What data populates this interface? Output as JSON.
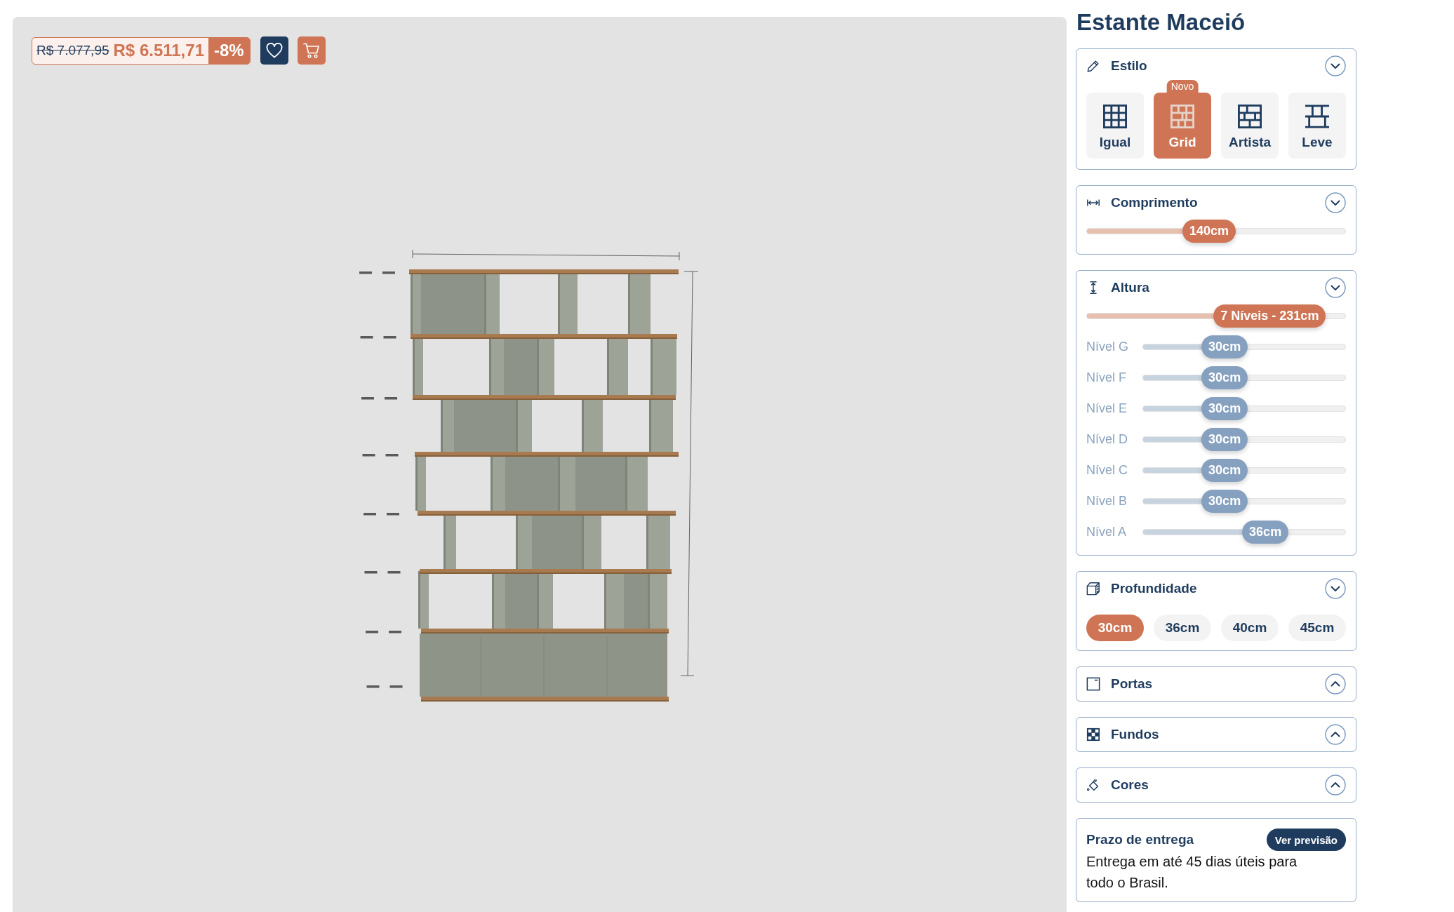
{
  "viewer": {
    "price": {
      "original": "R$ 7.077,95",
      "current": "R$ 6.511,71",
      "discount": "-8%"
    }
  },
  "product": {
    "title": "Estante Maceió"
  },
  "sections": [
    {
      "kind": "styles",
      "title": "Estilo",
      "expanded": true,
      "options": [
        {
          "label": "Igual",
          "selected": false
        },
        {
          "label": "Grid",
          "selected": true,
          "badge": "Novo"
        },
        {
          "label": "Artista",
          "selected": false
        },
        {
          "label": "Leve",
          "selected": false
        }
      ]
    },
    {
      "kind": "slider",
      "title": "Comprimento",
      "expanded": true,
      "slider": {
        "value": "140cm",
        "level": 0.37
      }
    },
    {
      "kind": "height",
      "title": "Altura",
      "expanded": true,
      "slider": {
        "value": "7 Níveis - 231cm",
        "level": 0.49
      },
      "levels": [
        {
          "label": "Nível G",
          "value": "30cm",
          "level": 0.29
        },
        {
          "label": "Nível F",
          "value": "30cm",
          "level": 0.29
        },
        {
          "label": "Nível E",
          "value": "30cm",
          "level": 0.29
        },
        {
          "label": "Nível D",
          "value": "30cm",
          "level": 0.29
        },
        {
          "label": "Nível C",
          "value": "30cm",
          "level": 0.29
        },
        {
          "label": "Nível B",
          "value": "30cm",
          "level": 0.29
        },
        {
          "label": "Nível A",
          "value": "36cm",
          "level": 0.49
        }
      ]
    },
    {
      "kind": "sizes",
      "title": "Profundidade",
      "expanded": true,
      "options": [
        {
          "label": "30cm",
          "selected": true
        },
        {
          "label": "36cm",
          "selected": false
        },
        {
          "label": "40cm",
          "selected": false
        },
        {
          "label": "45cm",
          "selected": false
        }
      ]
    },
    {
      "title": "Portas",
      "expanded": false
    },
    {
      "title": "Fundos",
      "expanded": false
    },
    {
      "title": "Cores",
      "expanded": false
    }
  ],
  "delivery": {
    "title": "Prazo de entrega",
    "button": "Ver previsão",
    "text": "Entrega em até 45 dias úteis para todo o Brasil."
  }
}
